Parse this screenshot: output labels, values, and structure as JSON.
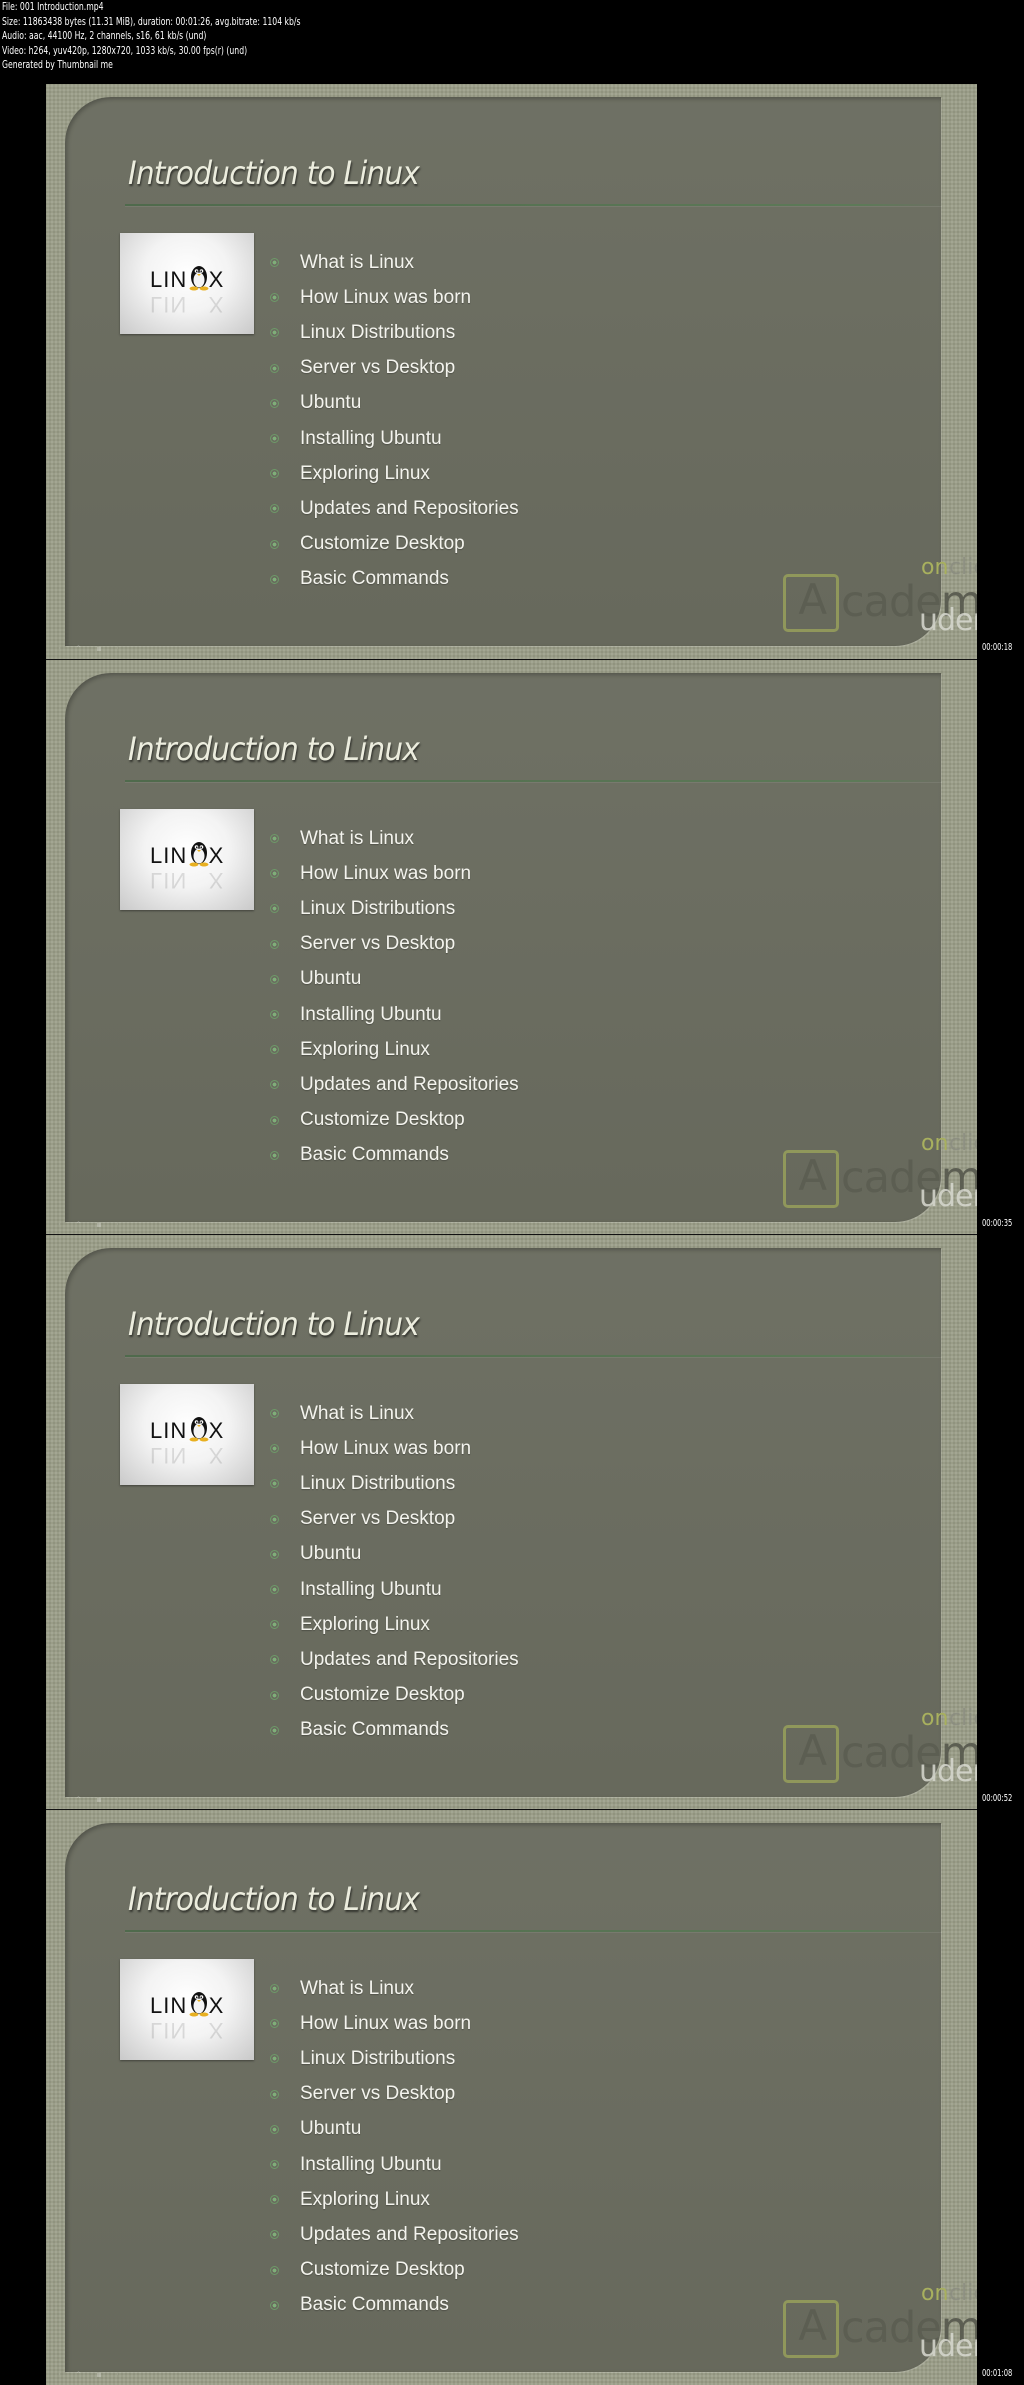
{
  "metadata": {
    "lines": [
      "File: 001 Introduction.mp4",
      "Size: 11863438 bytes (11.31 MiB), duration: 00:01:26, avg.bitrate: 1104 kb/s",
      "Audio: aac, 44100 Hz, 2 channels, s16, 61 kb/s (und)",
      "Video: h264, yuv420p, 1280x720, 1033 kb/s, 30.00 fps(r) (und)",
      "Generated by Thumbnail me"
    ]
  },
  "slide": {
    "title": "Introduction to Linux",
    "logo_text": "LIN X",
    "logo_icon": "tux-penguin-icon",
    "bullets": [
      "What is Linux",
      "How Linux was born",
      "Linux Distributions",
      "Server vs Desktop",
      "Ubuntu",
      "Installing Ubuntu",
      "Exploring Linux",
      "Updates and Repositories",
      "Customize Desktop",
      "Basic Commands"
    ],
    "watermark": {
      "bracket_letter": "[A]",
      "academy": "cademy",
      "on": "on",
      "click": "click",
      "udemy": "udemy"
    },
    "colors": {
      "frame": "#9a9d88",
      "panel": "#6a6c5f",
      "bullet": "#6d9a68",
      "text": "#f4f4ee",
      "accent": "#a8b05e"
    }
  },
  "frames": [
    {
      "timestamp": "00:00:18"
    },
    {
      "timestamp": "00:00:35"
    },
    {
      "timestamp": "00:00:52"
    },
    {
      "timestamp": "00:01:08"
    }
  ]
}
